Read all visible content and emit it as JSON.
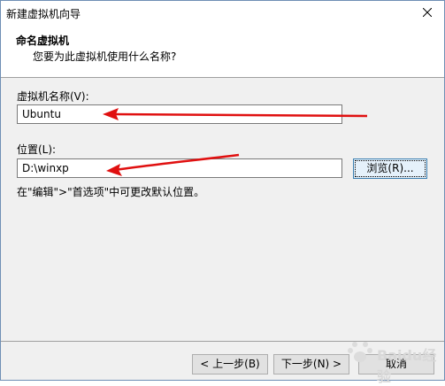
{
  "window": {
    "title": "新建虚拟机向导"
  },
  "header": {
    "title": "命名虚拟机",
    "subtitle": "您要为此虚拟机使用什么名称?"
  },
  "form": {
    "name_label": "虚拟机名称(V):",
    "name_value": "Ubuntu",
    "location_label": "位置(L):",
    "location_value": "D:\\winxp",
    "browse_label": "浏览(R)...",
    "hint": "在\"编辑\">\"首选项\"中可更改默认位置。"
  },
  "footer": {
    "back_label": "< 上一步(B)",
    "next_label": "下一步(N) >",
    "cancel_label": "取消"
  },
  "watermark": {
    "text": "Baidu经验"
  },
  "colors": {
    "arrow": "#e01010",
    "focus_border": "#3c7fb1",
    "window_border": "#6f8fb5"
  },
  "icons": {
    "close": "close-icon"
  }
}
